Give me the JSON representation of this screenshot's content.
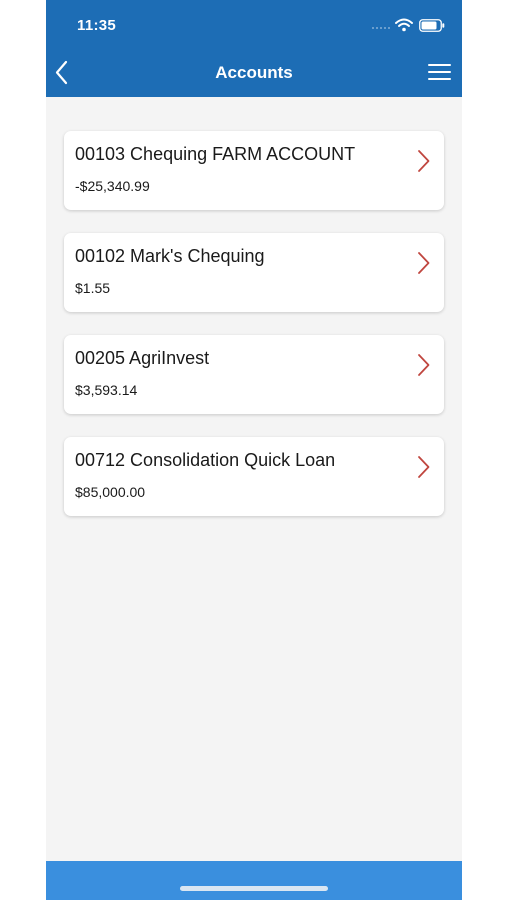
{
  "status_bar": {
    "time": "11:35"
  },
  "nav": {
    "title": "Accounts",
    "back_icon": "chevron-left-icon",
    "menu_icon": "hamburger-menu-icon"
  },
  "accounts": [
    {
      "name": "00103 Chequing FARM ACCOUNT",
      "balance": "-$25,340.99"
    },
    {
      "name": "00102 Mark's Chequing",
      "balance": "$1.55"
    },
    {
      "name": "00205 AgriInvest",
      "balance": "$3,593.14"
    },
    {
      "name": "00712 Consolidation Quick Loan",
      "balance": "$85,000.00"
    }
  ],
  "colors": {
    "header_blue": "#1d6db5",
    "bottom_bar_blue": "#3a8fde",
    "chevron_red": "#c0463f",
    "background": "#f4f4f4"
  }
}
